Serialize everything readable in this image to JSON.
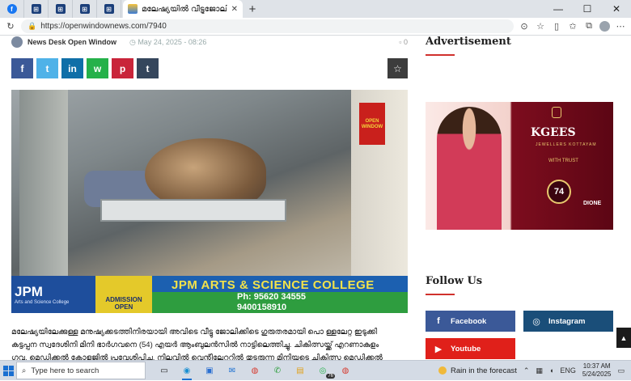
{
  "browser": {
    "active_tab_title": "മലേഷ്യയിൽ വീട്ടുജോലി...",
    "url": "https://openwindownews.com/7940",
    "minimize_glyph": "—",
    "maximize_glyph": "☐",
    "close_glyph": "✕",
    "new_tab_glyph": "+"
  },
  "article": {
    "author": "News Desk Open Window",
    "date": "May 24, 2025 - 08:26",
    "comments": "0",
    "share_buttons": [
      {
        "name": "facebook",
        "glyph": "f"
      },
      {
        "name": "twitter",
        "glyph": "t"
      },
      {
        "name": "linkedin",
        "glyph": "in"
      },
      {
        "name": "whatsapp",
        "glyph": "w"
      },
      {
        "name": "pinterest",
        "glyph": "p"
      },
      {
        "name": "tumblr",
        "glyph": "t"
      }
    ],
    "photo_logo_text": "OPEN WINDOW",
    "banner": {
      "logo": "JPM",
      "logo_sub": "Arts and Science College",
      "admission": "ADMISSION OPEN",
      "college": "JPM ARTS & SCIENCE COLLEGE",
      "phone_label": "Ph: 95620 34555",
      "phone_2": "9400158910"
    },
    "body_line_1": "മലേഷ്യയിലേക്കുള്ള മനുഷ്യക്കടത്തിനിരയായി അവിടെ വീട്ടു ജോലിക്കിടെ ഗുരുതരമായി പൊ ള്ളലേറ്റ ഇടുക്കി",
    "body_line_2": "കട്ടപ്പന സ്വദേശിനി മിനി ഭാർഗവനെ (54) എയർ ആംബുലൻസിൽ നാട്ടിലെത്തിച്ചു. ചികിത്സയ്ക്ക് എറണാകുളം",
    "body_line_3": "ഗവ. മെഡിക്കൽ കോളജിൽ പ്രവേശിപ്പിച്ചു. നിലവിൽ വെന്റിലേറ്ററിൽ തുടരുന്ന മിനിയുടെ ചികിത്സ മെഡിക്കൽ"
  },
  "sidebar": {
    "ad_heading": "Advertisement",
    "kgees_ad": {
      "brand": "KGEES",
      "sub": "JEWELLERS KOTTAYAM",
      "tagline": "WITH TRUST",
      "years": "74",
      "partner": "DIONE"
    },
    "follow_heading": "Follow Us",
    "follow_buttons": [
      {
        "label": "Facebook",
        "glyph": "f"
      },
      {
        "label": "Instagram",
        "glyph": "◎"
      },
      {
        "label": "Youtube",
        "glyph": "▶"
      }
    ]
  },
  "taskbar": {
    "search_placeholder": "Type here to search",
    "whatsapp_badge": "76",
    "weather": "Rain in the forecast",
    "language": "ENG",
    "time": "10:37 AM",
    "date": "5/24/2025"
  },
  "colors": {
    "accent_red": "#d0312d",
    "facebook": "#3b5998",
    "instagram": "#1a4e79",
    "youtube": "#e0201a"
  }
}
